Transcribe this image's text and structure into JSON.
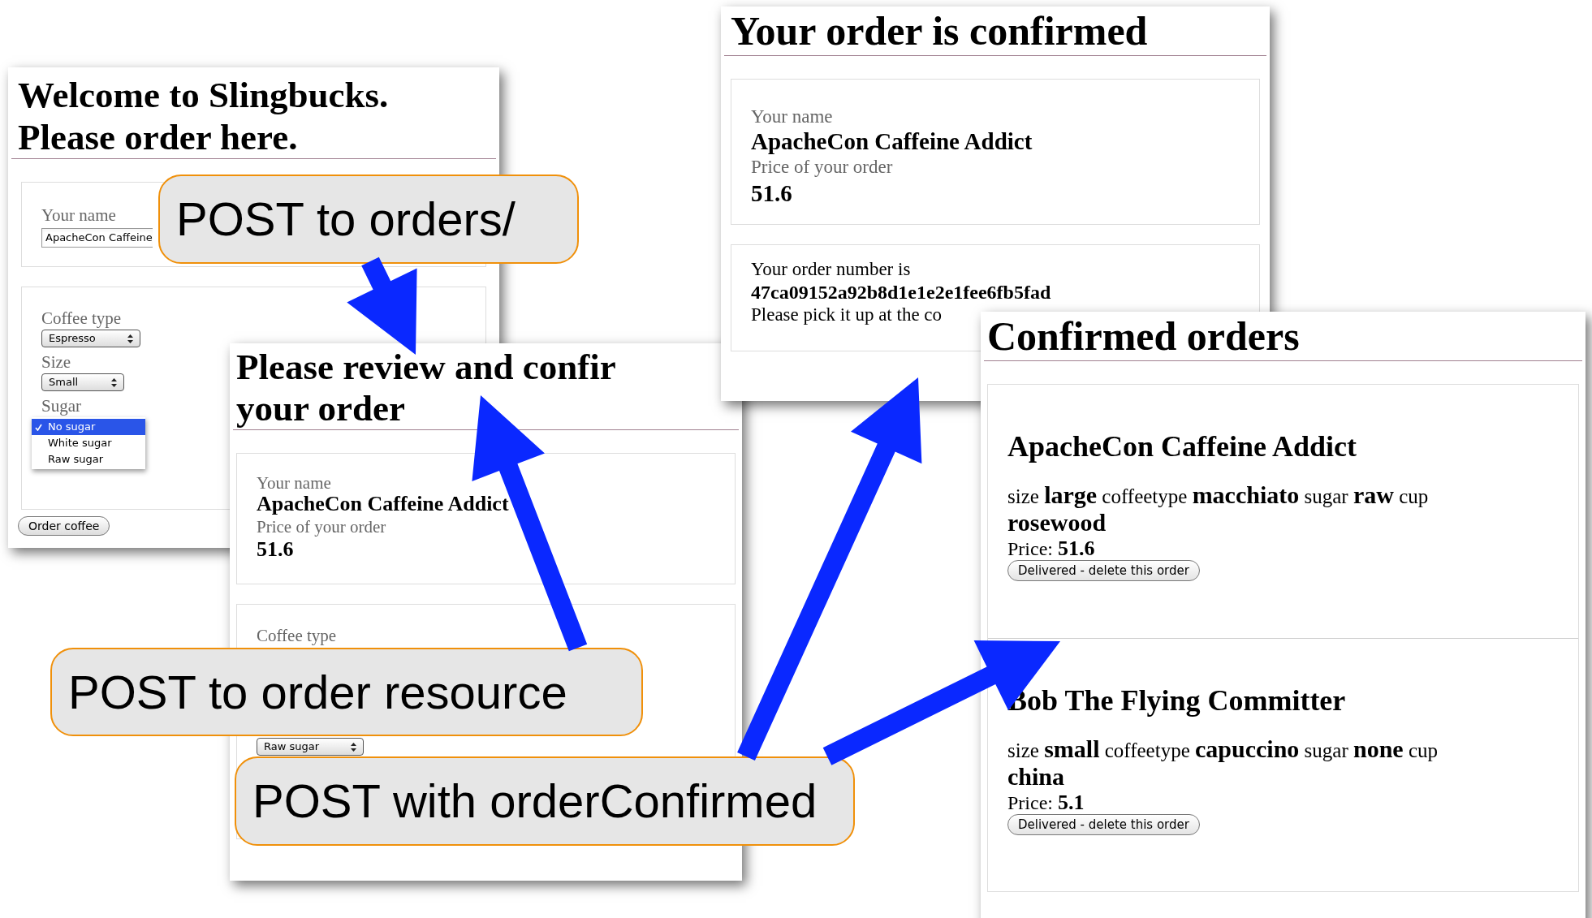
{
  "order_form": {
    "title_lines": [
      "Welcome to Slingbucks.",
      "Please order here."
    ],
    "name_label": "Your name",
    "name_value": "ApacheCon Caffeine",
    "fields": [
      {
        "label": "Coffee type",
        "value": "Espresso"
      },
      {
        "label": "Size",
        "value": "Small"
      }
    ],
    "sugar_label": "Sugar",
    "sugar_options": [
      {
        "label": "No sugar",
        "selected": true
      },
      {
        "label": "White sugar",
        "selected": false
      },
      {
        "label": "Raw sugar",
        "selected": false
      }
    ],
    "submit": "Order coffee"
  },
  "review": {
    "title_lines": [
      "Please review and confir",
      "your order"
    ],
    "name_label": "Your name",
    "name_value": "ApacheCon Caffeine Addict",
    "price_label": "Price of your order",
    "price": "51.6",
    "coffee_type_label": "Coffee type",
    "sugar_value": "Raw sugar"
  },
  "confirmation": {
    "title": "Your order is confirmed",
    "name_label": "Your name",
    "name_value": "ApacheCon Caffeine Addict",
    "price_label": "Price of your order",
    "price": "51.6",
    "order_number_label": "Your order number is",
    "order_number": "47ca09152a92b8d1e1e2e1fee6fb5fad",
    "pickup_note": "Please pick it up at the co"
  },
  "orders_list": {
    "title": "Confirmed orders",
    "orders": [
      {
        "name": "ApacheCon Caffeine Addict",
        "details": "size **large** coffeetype **macchiato** sugar **raw** cup **rosewood**",
        "price": "Price: **51.6**",
        "button": "Delivered - delete this order"
      },
      {
        "name": "Bob The Flying Committer",
        "details": "size **small** coffeetype **capuccino** sugar **none** cup **china**",
        "price": "Price: **5.1**",
        "button": "Delivered - delete this order"
      }
    ]
  },
  "callouts": [
    "POST to orders/",
    "POST to order resource",
    "POST with orderConfirmed"
  ]
}
